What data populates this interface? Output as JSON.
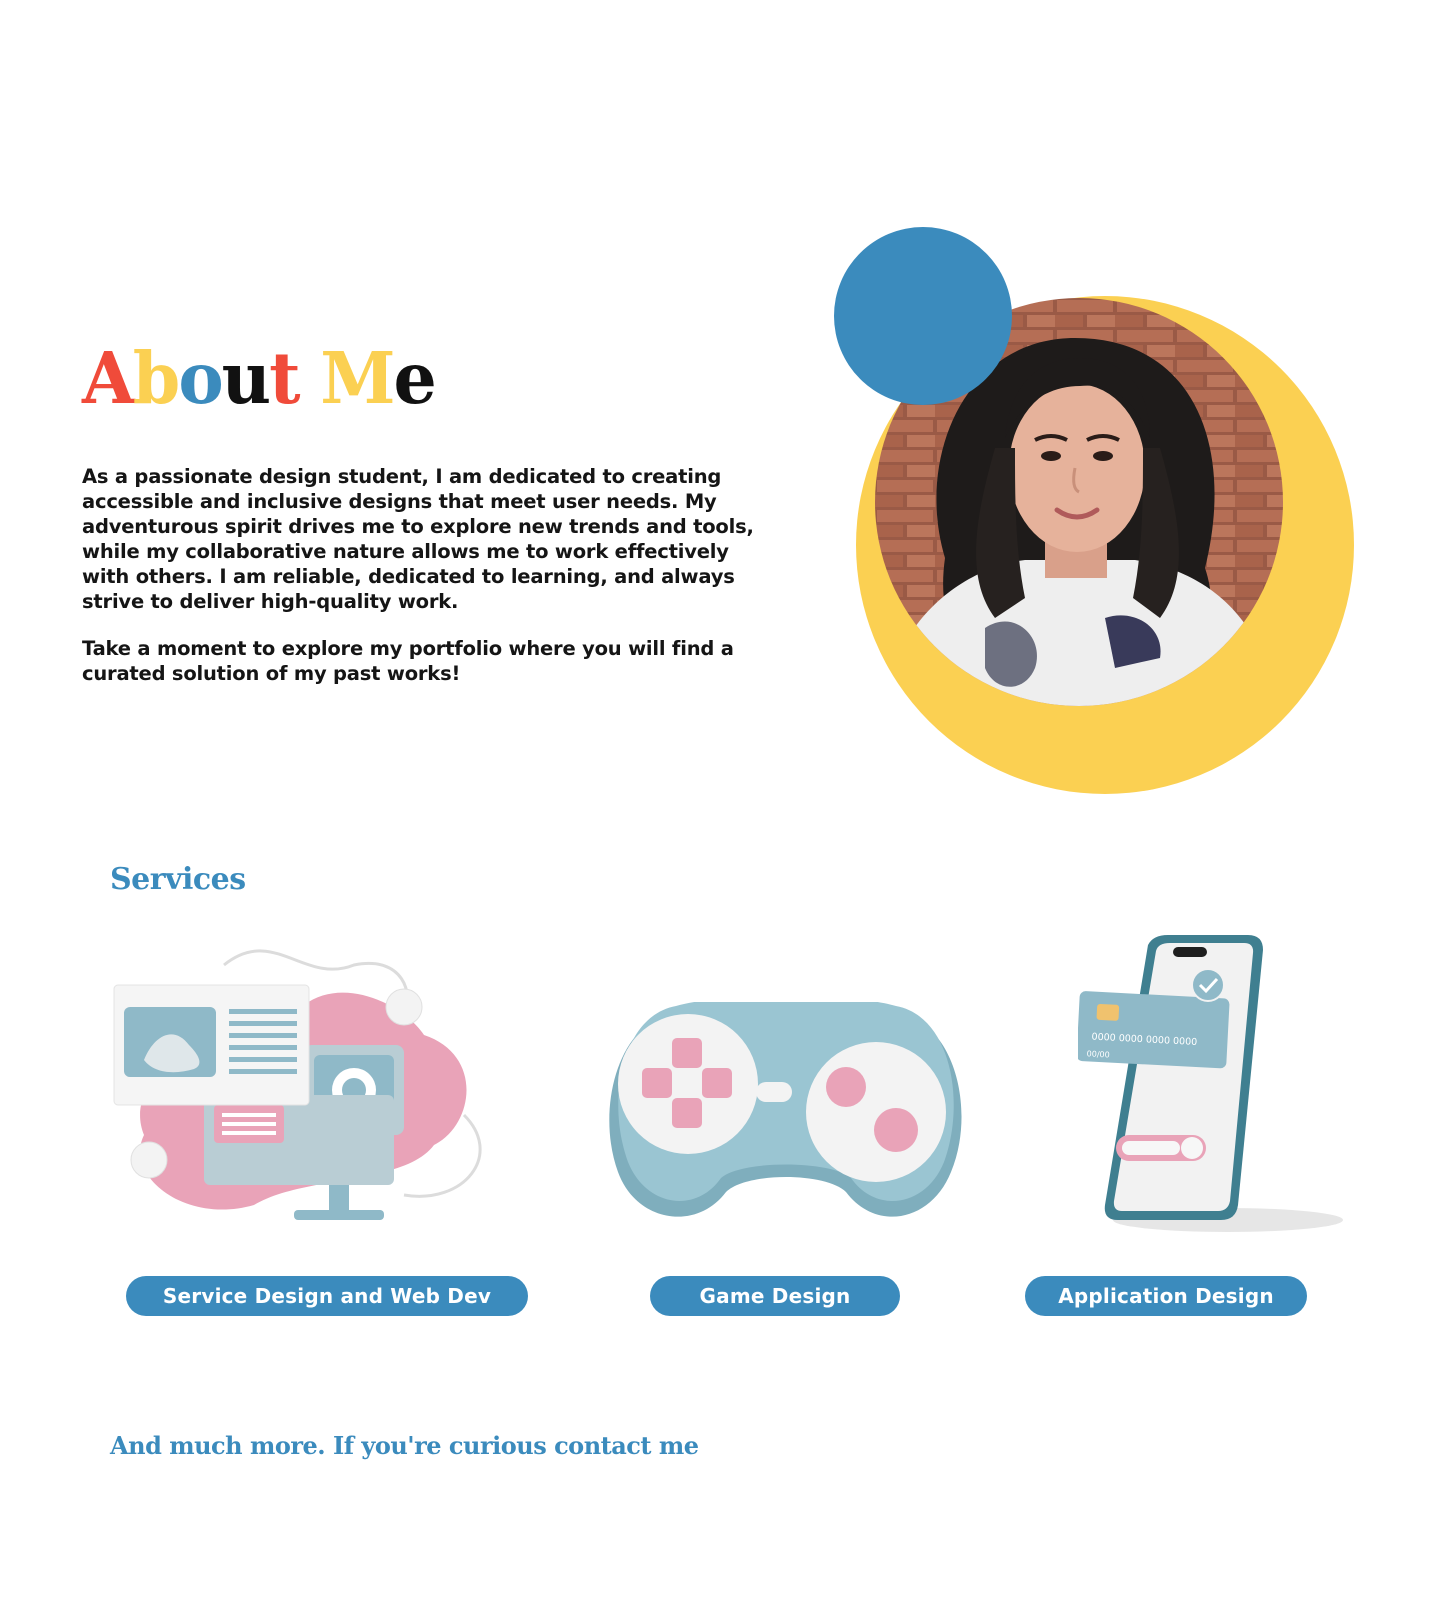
{
  "about": {
    "title_letters": [
      {
        "char": "A",
        "color": "#f04b3a"
      },
      {
        "char": "b",
        "color": "#fbd052"
      },
      {
        "char": "o",
        "color": "#3b8bbd"
      },
      {
        "char": "u",
        "color": "#111111"
      },
      {
        "char": "t",
        "color": "#f04b3a"
      },
      {
        "char": " ",
        "color": "#111111"
      },
      {
        "char": "M",
        "color": "#fbd052"
      },
      {
        "char": "e",
        "color": "#111111"
      }
    ],
    "bio": "As a passionate design student, I am dedicated to creating accessible and inclusive designs that meet user needs. My adventurous spirit drives me to explore new trends and tools, while my collaborative nature allows me to work effectively with others. I am reliable, dedicated to learning, and always strive to deliver high-quality work.",
    "explore": "Take a moment to explore my portfolio where you will find a curated solution of my past works!",
    "portrait_icon": "portrait-photo",
    "colors": {
      "blue": "#3b8bbd",
      "yellow": "#fbd052",
      "red": "#f04b3a",
      "pink": "#e9a3b8",
      "teal": "#8fb9c8"
    }
  },
  "services": {
    "title": "Services",
    "items": [
      {
        "label": "Service Design and Web Dev",
        "icon": "web-design-illustration"
      },
      {
        "label": "Game Design",
        "icon": "gamepad-illustration"
      },
      {
        "label": "Application Design",
        "icon": "phone-payment-illustration"
      }
    ],
    "card_text": {
      "number": "0000 0000 0000 0000",
      "expiry": "00/00"
    }
  },
  "contact": {
    "cta": "And much more. If you're curious contact me"
  }
}
